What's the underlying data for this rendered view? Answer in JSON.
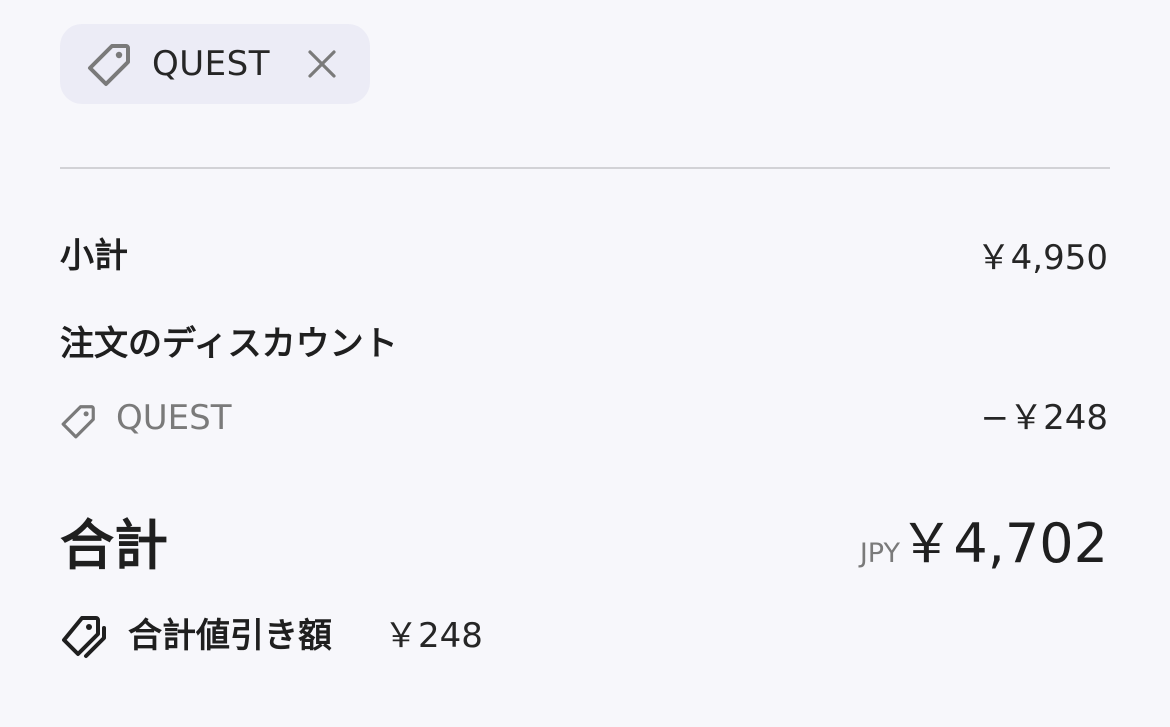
{
  "discount_chip": {
    "code": "QUEST",
    "icon": "tag-icon",
    "remove_icon": "close-icon"
  },
  "summary": {
    "subtotal_label": "小計",
    "subtotal_value": "￥4,950",
    "order_discount_label": "注文のディスカウント",
    "discount_code": "QUEST",
    "discount_value": "−￥248",
    "total_label": "合計",
    "currency": "JPY",
    "total_value": "￥4,702",
    "total_savings_label": "合計値引き額",
    "total_savings_value": "￥248"
  },
  "colors": {
    "background": "#f7f7fb",
    "chip_background": "#ececf6",
    "divider": "#d2d2d6",
    "muted_text": "#7a7a7a",
    "primary_text": "#1f1f1f"
  }
}
